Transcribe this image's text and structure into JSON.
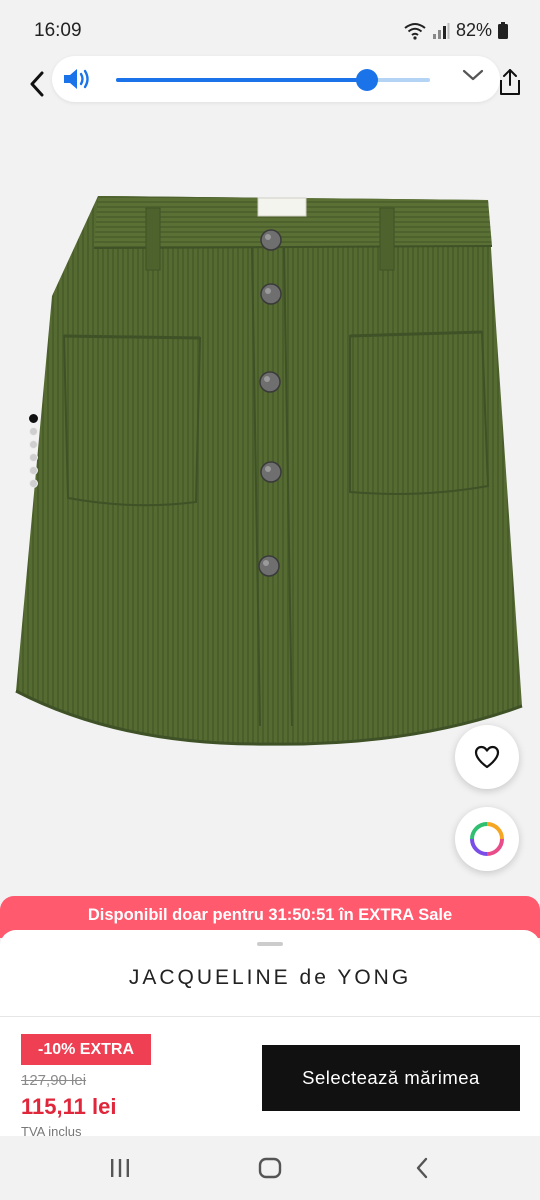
{
  "status_bar": {
    "time": "16:09",
    "battery": "82%"
  },
  "volume": {
    "level": 0.8
  },
  "product": {
    "image_pager": {
      "count": 6,
      "active_index": 0
    }
  },
  "sale_banner": {
    "text": "Disponibil doar pentru 31:50:51 în EXTRA Sale"
  },
  "brand": "JACQUELINE de YONG",
  "pricing": {
    "badge": "-10% EXTRA",
    "old_price": "127,90 lei",
    "new_price": "115,11 lei",
    "vat_note": "TVA inclus"
  },
  "cta": {
    "select_size_label": "Selectează mărimea"
  },
  "colors": {
    "accent_blue": "#1a73e8",
    "sale_banner": "#ff5a6e",
    "badge_red": "#ef3f53",
    "price_red": "#e0263a",
    "button_black": "#111111",
    "skirt_green": "#556b32"
  },
  "icons": {
    "back": "chevron-left-icon",
    "volume": "speaker-icon",
    "expand": "chevron-down-icon",
    "share": "share-icon",
    "favorite": "heart-icon",
    "color_picker": "color-wheel-icon",
    "nav_recents": "recents-icon",
    "nav_home": "home-icon",
    "nav_back": "back-icon"
  }
}
